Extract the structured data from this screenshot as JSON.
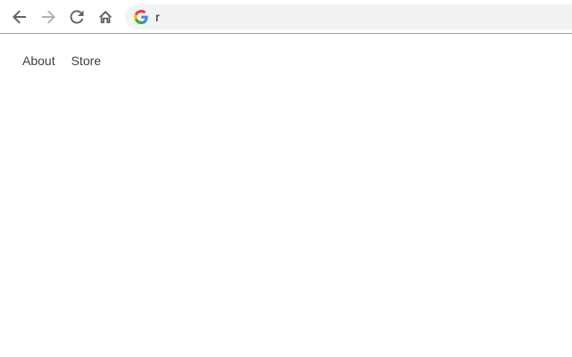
{
  "browser": {
    "address_bar": {
      "value": "r",
      "placeholder": ""
    },
    "icons": {
      "back": "arrow-left-icon",
      "forward": "arrow-right-icon",
      "reload": "reload-icon",
      "home": "home-icon",
      "search_engine": "google-g-icon"
    },
    "colors": {
      "icon_active": "#5f6368",
      "icon_disabled": "#b3b3b3",
      "omnibox_bg": "#f1f3f4"
    }
  },
  "page": {
    "links": [
      {
        "label": "About"
      },
      {
        "label": "Store"
      }
    ]
  }
}
